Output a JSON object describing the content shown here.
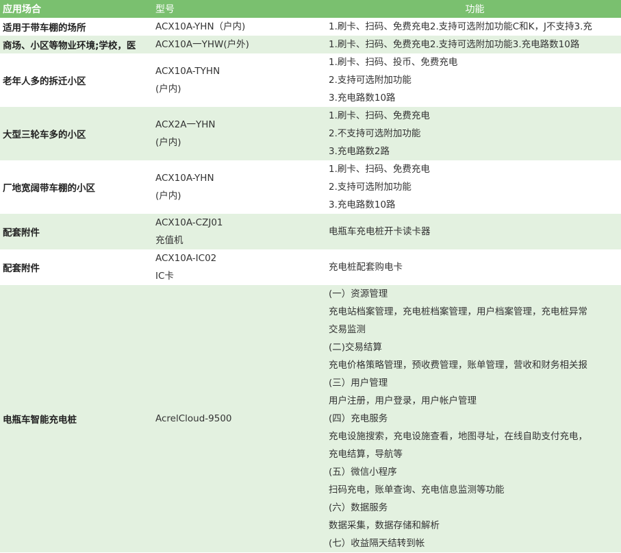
{
  "header": {
    "c1": "应用场合",
    "c2": "型号",
    "c3": "功能"
  },
  "rows": [
    {
      "scene": "适用于带车棚的场所",
      "model": [
        "ACX10A-YHN（户内)"
      ],
      "func": [
        "1.刷卡、扫码、免费充电2.支持可选附加功能C和K，J不支持3.充"
      ]
    },
    {
      "scene": "商场、小区等物业环境;学校，医",
      "model": [
        "ACX10A一YHW(户外)"
      ],
      "func": [
        "1.刷卡、扫码、免费充电2.支持可选附加功能3.充电路数10路"
      ]
    },
    {
      "scene": "老年人多的拆迁小区",
      "model": [
        "ACX10A-TYHN",
        "(户内)"
      ],
      "func": [
        "1.刷卡、扫码、投币、免费充电",
        "2.支持可选附加功能",
        "3.充电路数10路"
      ]
    },
    {
      "scene": "大型三轮车多的小区",
      "model": [
        "ACX2A一YHN",
        "(户内)"
      ],
      "func": [
        "1.刷卡、扫码、免费充电",
        "2.不支持可选附加功能",
        "3.充电路数2路"
      ]
    },
    {
      "scene": "厂地宽阔带车棚的小区",
      "model": [
        "ACX10A-YHN",
        "(户内)"
      ],
      "func": [
        "1.刷卡、扫码、免费充电",
        "2.支持可选附加功能",
        "3.充电路数10路"
      ]
    },
    {
      "scene": "配套附件",
      "model": [
        "ACX10A-CZJ01",
        "充值机"
      ],
      "func": [
        "电瓶车充电桩开卡读卡器"
      ]
    },
    {
      "scene": "配套附件",
      "model": [
        "ACX10A-IC02",
        "IC卡"
      ],
      "func": [
        "充电桩配套购电卡"
      ]
    },
    {
      "scene": "电瓶车智能充电桩",
      "model": [
        "AcrelCloud-9500"
      ],
      "func": [
        "(一）资源管理",
        "充电站档案管理，充电桩档案管理，用户档案管理，充电桩异常",
        "交易监测",
        "(二)交易结算",
        "充电价格策略管理，预收费管理，账单管理，营收和财务相关报",
        "(三）用户管理",
        "用户注册，用户登录，用户帐户管理",
        "(四）充电服务",
        "充电设施搜索，充电设施查看，地图寻址，在线自助支付充电，",
        "充电结算，导航等",
        "(五）微信小程序",
        "扫码充电，账单查询、充电信息监测等功能",
        "(六）数据服务",
        "数据采集，数据存储和解析",
        "(七）收益隔天结转到帐"
      ]
    }
  ]
}
